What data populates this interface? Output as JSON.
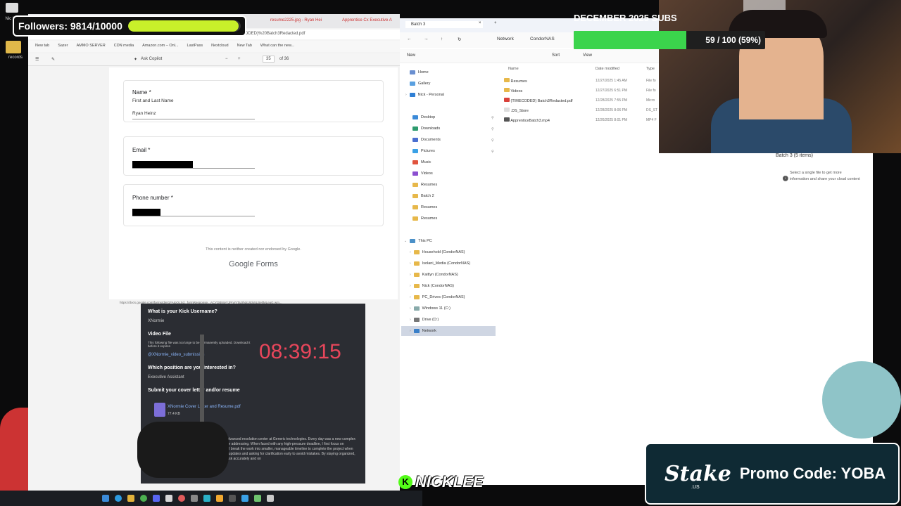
{
  "desktop": {
    "icons": [
      {
        "label": "Nic Main S"
      },
      {
        "label": "records"
      }
    ]
  },
  "followers": {
    "label": "Followers: 9814/10000",
    "progress": 0.9814,
    "color": "#c8f02a"
  },
  "subs": {
    "title": "DECEMBER 2025 SUBS",
    "progress_text": "59 / 100 (59%)",
    "progress": 0.59,
    "color": "#3bd44c"
  },
  "browser": {
    "tabs": [
      "resume2225.jpg - Ryan Hei",
      "Apprentice Cx Executive A"
    ],
    "url": "%203/(TIMECODED)%20Batch3Redacted.pdf",
    "bookmarks": [
      "New tab",
      "Sazer",
      "AMMO SERVER",
      "CDN media",
      "Amazon.com – Onl...",
      "LastPass",
      "Nextcloud",
      "New Tab",
      "What can the new..."
    ],
    "pdf_toolbar": {
      "copilot": "Ask Copilot",
      "page": "35",
      "of": "of 36"
    },
    "form": {
      "name_q": "Name *",
      "name_hint": "First and Last Name",
      "name_value": "Ryan Heinz",
      "email_q": "Email *",
      "phone_q": "Phone number *",
      "disclaimer": "This content is neither created nor endorsed by Google.",
      "brand": "Google Forms",
      "url": "https://docs.google.com/forms/d/e/1FAIpQLSd...formResponse...ACYDBNjvYJPryiYTaJIhdgJtdo5LBeltMLeaG wm..."
    }
  },
  "dark_form": {
    "q1": "What is your Kick Username?",
    "a1": "XNormie",
    "q2": "Video File",
    "note": "This following file was too large to be permanently uploaded. Download it before it expires",
    "link": "@XNormie_video_submission",
    "q3": "Which position are you interested in?",
    "a3": "Executive Assistant",
    "q4": "Submit your cover letter and/or resume",
    "file": "XNormie Cover Letter and Resume.pdf",
    "file_size": "77.4 KB",
    "para": "I have been working in and further developing the advanced resolution center at Generic technologies. Every day was a new complex issue without a developed road map or processes for addressing. When faced with any high-pressure deadline, I first focus on questions scope of the task and the exact deadline. I break the work into smaller, manageable timeline to complete the project when needed. I also communicate clearly with the people updates and asking for clarification early to avoid mistakes. By staying organized, focused, I have always been able to complete the task accurately and on"
  },
  "timer": "08:39:15",
  "explorer": {
    "tab": "Batch 3",
    "breadcrumb": [
      "Network",
      "CondorNAS"
    ],
    "cmd": {
      "new": "New",
      "sort": "Sort",
      "view": "View"
    },
    "cols": {
      "name": "Name",
      "date": "Date modified",
      "type": "Type"
    },
    "nav_top": [
      {
        "label": "Home"
      },
      {
        "label": "Gallery"
      },
      {
        "label": "Nick - Personal"
      }
    ],
    "nav_quick": [
      {
        "label": "Desktop"
      },
      {
        "label": "Downloads"
      },
      {
        "label": "Documents"
      },
      {
        "label": "Pictures"
      },
      {
        "label": "Music"
      },
      {
        "label": "Videos"
      },
      {
        "label": "Resumes"
      },
      {
        "label": "Batch 2"
      },
      {
        "label": "Resumes"
      },
      {
        "label": "Resumes"
      }
    ],
    "nav_pc": [
      {
        "label": "This PC"
      },
      {
        "label": "Household (CondorNAS)"
      },
      {
        "label": "Isolani_Media (CondorNAS)"
      },
      {
        "label": "Kaitlyn (CondorNAS)"
      },
      {
        "label": "Nick (CondorNAS)"
      },
      {
        "label": "PC_Drives (CondorNAS)"
      },
      {
        "label": "Windows 11 (C:)"
      },
      {
        "label": "Drive (D:)"
      },
      {
        "label": "Network"
      }
    ],
    "files": [
      {
        "name": "Resumes",
        "date": "12/27/2025 1:45 AM",
        "type": "File fo"
      },
      {
        "name": "Videos",
        "date": "12/27/2025 6:51 PM",
        "type": "File fo"
      },
      {
        "name": "(TIMECODED) Batch3Redacted.pdf",
        "date": "12/28/2025 7:55 PM",
        "type": "Micro"
      },
      {
        "name": ".DS_Store",
        "date": "12/28/2025 8:06 PM",
        "type": "DS_ST"
      },
      {
        "name": "ApprenticeBatch3.mp4",
        "date": "12/26/2025 8:01 PM",
        "type": "MP4 F"
      }
    ],
    "details_title": "Batch 3 (5 items)",
    "details_hint": "Select a single file to get more information and share your cloud content"
  },
  "overlay": {
    "streamer": "NICKLEE",
    "kick_letter": "K",
    "stake_logo": "Stake",
    "stake_sub": ".US",
    "promo": "Promo Code: YOBA"
  }
}
